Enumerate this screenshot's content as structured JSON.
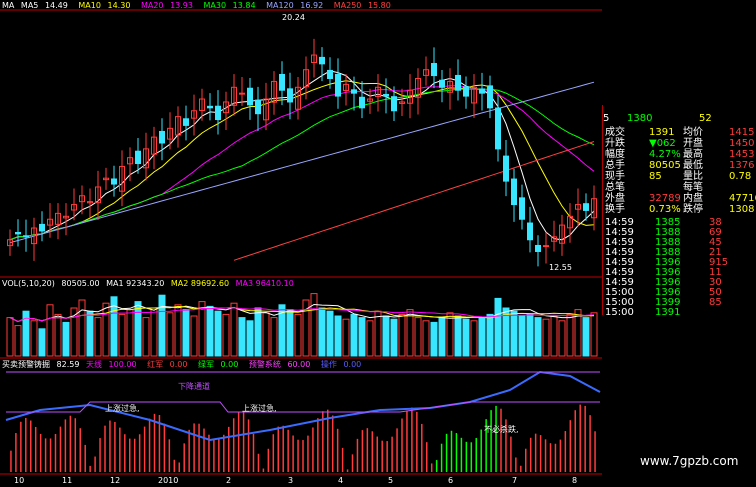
{
  "colors": {
    "up": "#ff3b3b",
    "down": "#38e6ff",
    "ma5": "#ffffff",
    "ma10": "#ffff00",
    "ma20": "#ff00ff",
    "ma30": "#00ff00",
    "ma120": "#9aa7ff",
    "ma250": "#ff4040",
    "grid": "#b00000",
    "axis": "#c00000",
    "green": "#00ff00",
    "yellow": "#ffff00"
  },
  "header": {
    "ma_prefix": "MA",
    "items": [
      {
        "label": "MA5",
        "value": "14.49"
      },
      {
        "label": "MA10",
        "value": "14.30"
      },
      {
        "label": "MA20",
        "value": "13.93"
      },
      {
        "label": "MA30",
        "value": "13.84"
      },
      {
        "label": "MA120",
        "value": "16.92"
      },
      {
        "label": "MA250",
        "value": "15.80"
      }
    ]
  },
  "price_panel": {
    "high_label": "20.24",
    "low_label": "12.55"
  },
  "volume_panel": {
    "title": "VOL(5,10,20)",
    "values": [
      "80505.00",
      "MA1 92343.20",
      "MA2 89692.60",
      "MA3 96410.10"
    ]
  },
  "indicator_panel": {
    "title": "买卖预警铸掘",
    "title_value": "82.59",
    "legend": [
      {
        "name": "天线",
        "value": "100.00"
      },
      {
        "name": "红军",
        "value": "0.00"
      },
      {
        "name": "绿军",
        "value": "0.00"
      },
      {
        "name": "预警系统",
        "value": "60.00"
      },
      {
        "name": "操作",
        "value": "0.00"
      }
    ],
    "annotations": [
      "下降通道",
      "上涨过急,",
      "上涨过急,",
      "不必杀跌,"
    ]
  },
  "x_axis": {
    "labels": [
      "10",
      "11",
      "12",
      "2010",
      "2",
      "3",
      "4",
      "5",
      "6",
      "7",
      "8"
    ]
  },
  "quote_panel": {
    "top_row": [
      "5",
      "1380",
      "52"
    ],
    "rows": [
      {
        "l": "成交",
        "lv": "1391",
        "r": "均价",
        "rv": "1415"
      },
      {
        "l": "升跌",
        "lv": "▼062",
        "r": "开盘",
        "rv": "1450"
      },
      {
        "l": "幅度",
        "lv": "4.27%",
        "r": "最高",
        "rv": "1453"
      },
      {
        "l": "总手",
        "lv": "80505",
        "r": "最低",
        "rv": "1376"
      },
      {
        "l": "现手",
        "lv": "85",
        "r": "量比",
        "rv": "0.78"
      },
      {
        "l": "总笔",
        "lv": "",
        "r": "每笔",
        "rv": ""
      },
      {
        "l": "外盘",
        "lv": "32789",
        "r": "内盘",
        "rv": "47716"
      },
      {
        "l": "换手",
        "lv": "0.73%",
        "r": "跌停",
        "rv": "1308"
      }
    ],
    "ticks": [
      {
        "t": "14:59",
        "p": "1385",
        "v": "38"
      },
      {
        "t": "14:59",
        "p": "1388",
        "v": "69"
      },
      {
        "t": "14:59",
        "p": "1388",
        "v": "45"
      },
      {
        "t": "14:59",
        "p": "1388",
        "v": "21"
      },
      {
        "t": "14:59",
        "p": "1396",
        "v": "915"
      },
      {
        "t": "14:59",
        "p": "1396",
        "v": "11"
      },
      {
        "t": "14:59",
        "p": "1396",
        "v": "30"
      },
      {
        "t": "15:00",
        "p": "1396",
        "v": "50"
      },
      {
        "t": "15:00",
        "p": "1399",
        "v": "85"
      },
      {
        "t": "15:00",
        "p": "1391",
        "v": ""
      }
    ]
  },
  "watermark": "www.7gpzb.com",
  "chart_data": {
    "type": "candlestick",
    "title": "",
    "closes": [
      13.1,
      13.3,
      13.2,
      13.5,
      13.4,
      13.8,
      14.0,
      13.9,
      14.3,
      14.6,
      14.4,
      14.9,
      15.2,
      15.0,
      15.6,
      15.9,
      15.7,
      16.2,
      16.6,
      16.4,
      16.9,
      17.3,
      17.0,
      17.5,
      17.9,
      17.6,
      17.2,
      17.8,
      18.3,
      18.1,
      17.7,
      17.4,
      17.9,
      18.5,
      18.2,
      17.8,
      18.3,
      18.9,
      19.4,
      19.1,
      18.6,
      18.0,
      18.4,
      18.1,
      17.6,
      17.9,
      18.3,
      18.0,
      17.5,
      17.8,
      18.2,
      18.6,
      18.9,
      18.7,
      18.3,
      18.5,
      18.2,
      18.0,
      18.3,
      18.1,
      17.6,
      16.2,
      15.1,
      14.3,
      13.8,
      13.1,
      12.7,
      12.9,
      13.2,
      13.6,
      13.9,
      14.3,
      14.1,
      14.5
    ],
    "volume": [
      120,
      95,
      140,
      110,
      85,
      160,
      130,
      105,
      150,
      175,
      140,
      120,
      165,
      185,
      130,
      145,
      170,
      120,
      150,
      190,
      135,
      160,
      145,
      125,
      170,
      155,
      140,
      130,
      165,
      120,
      110,
      150,
      135,
      120,
      160,
      145,
      130,
      175,
      195,
      150,
      140,
      125,
      115,
      130,
      120,
      110,
      140,
      125,
      115,
      130,
      145,
      120,
      110,
      105,
      120,
      135,
      125,
      115,
      110,
      120,
      130,
      180,
      150,
      140,
      125,
      130,
      120,
      115,
      125,
      110,
      130,
      145,
      120,
      135
    ]
  }
}
